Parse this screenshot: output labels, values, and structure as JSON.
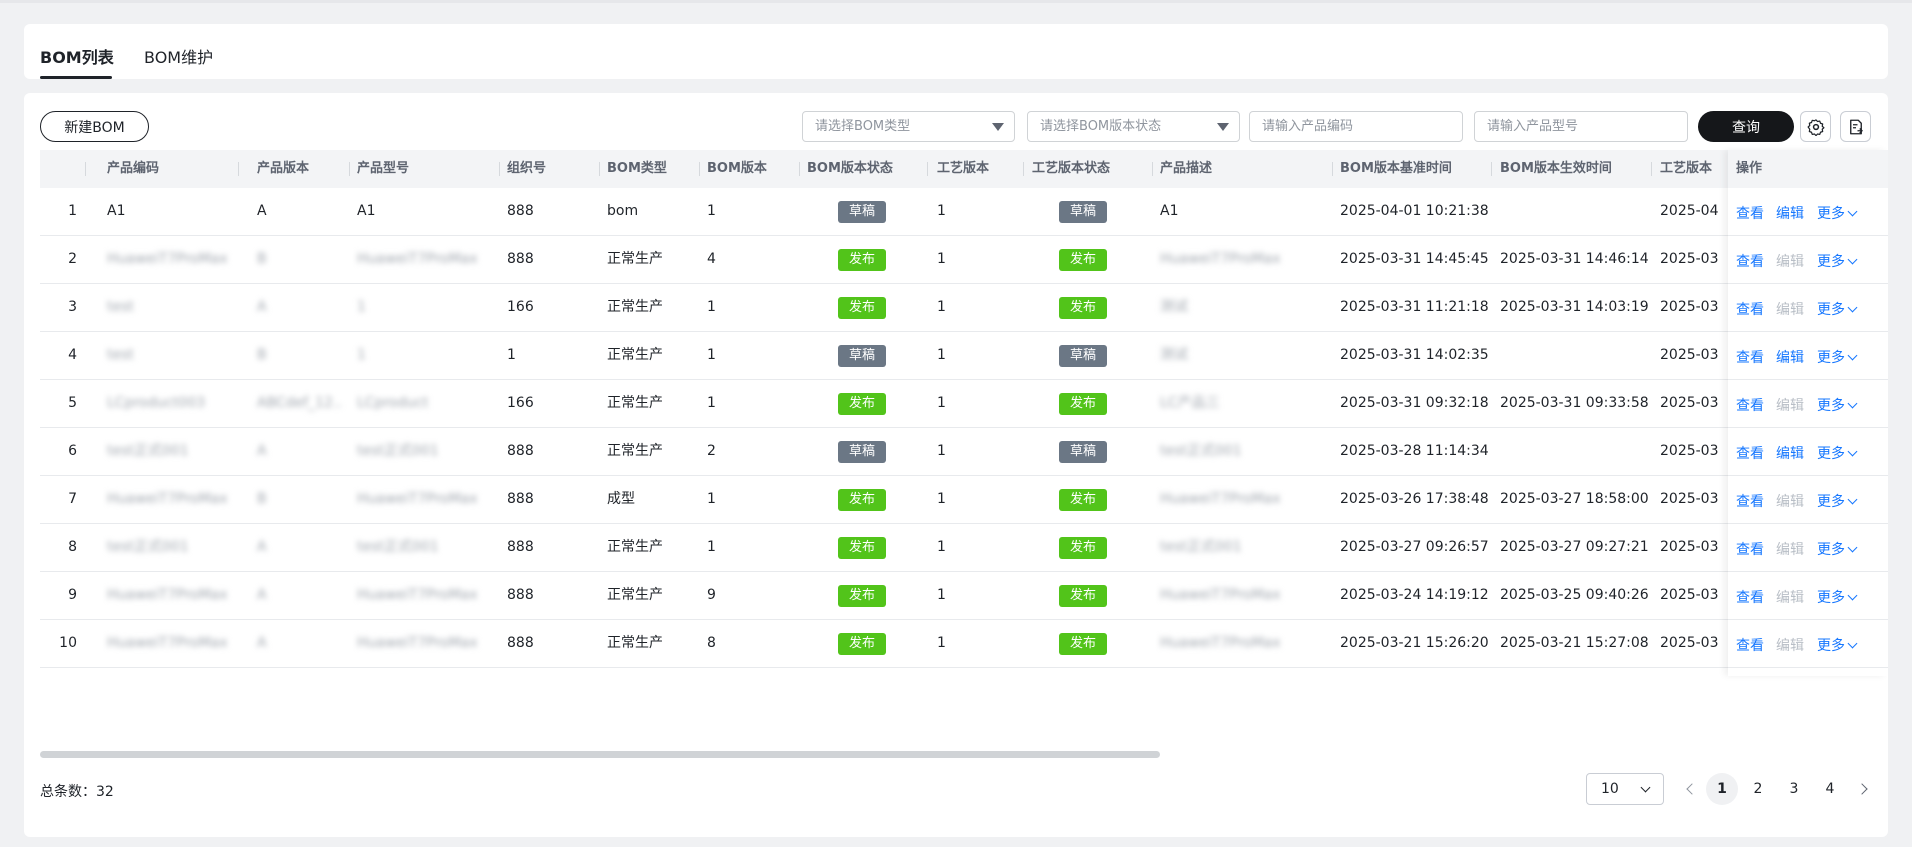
{
  "tabs": [
    {
      "label": "BOM列表",
      "active": true
    },
    {
      "label": "BOM维护",
      "active": false
    }
  ],
  "toolbar": {
    "new_button": "新建BOM",
    "bom_type_placeholder": "请选择BOM类型",
    "bom_status_placeholder": "请选择BOM版本状态",
    "product_code_placeholder": "请输入产品编码",
    "product_model_placeholder": "请输入产品型号",
    "query_button": "查询"
  },
  "columns": [
    "产品编码",
    "产品版本",
    "产品型号",
    "组织号",
    "BOM类型",
    "BOM版本",
    "BOM版本状态",
    "工艺版本",
    "工艺版本状态",
    "产品描述",
    "BOM版本基准时间",
    "BOM版本生效时间",
    "工艺版本",
    "操作"
  ],
  "rows": [
    {
      "idx": "1",
      "code": "A1",
      "ver": "A",
      "model": "A1",
      "org": "888",
      "type": "bom",
      "bomver": "1",
      "bomstatus": "草稿",
      "procver": "1",
      "procstatus": "草稿",
      "desc": "A1",
      "basetime": "2025-04-01 10:21:38",
      "efftime": "",
      "proc2": "2025-04",
      "blur": false
    },
    {
      "idx": "2",
      "code": "HuaweiT7ProMax",
      "ver": "B",
      "model": "HuaweiT7ProMax",
      "org": "888",
      "type": "正常生产",
      "bomver": "4",
      "bomstatus": "发布",
      "procver": "1",
      "procstatus": "发布",
      "desc": "HuaweiT7ProMax",
      "basetime": "2025-03-31 14:45:45",
      "efftime": "2025-03-31 14:46:14",
      "proc2": "2025-03",
      "blur": true
    },
    {
      "idx": "3",
      "code": "test",
      "ver": "A",
      "model": "1",
      "org": "166",
      "type": "正常生产",
      "bomver": "1",
      "bomstatus": "发布",
      "procver": "1",
      "procstatus": "发布",
      "desc": "测试",
      "basetime": "2025-03-31 11:21:18",
      "efftime": "2025-03-31 14:03:19",
      "proc2": "2025-03",
      "blur": true
    },
    {
      "idx": "4",
      "code": "test",
      "ver": "B",
      "model": "1",
      "org": "1",
      "type": "正常生产",
      "bomver": "1",
      "bomstatus": "草稿",
      "procver": "1",
      "procstatus": "草稿",
      "desc": "测试",
      "basetime": "2025-03-31 14:02:35",
      "efftime": "",
      "proc2": "2025-03",
      "blur": true
    },
    {
      "idx": "5",
      "code": "LCproduct003",
      "ver": "ABCdef_12...",
      "model": "LCproduct",
      "org": "166",
      "type": "正常生产",
      "bomver": "1",
      "bomstatus": "发布",
      "procver": "1",
      "procstatus": "发布",
      "desc": "LC产品三",
      "basetime": "2025-03-31 09:32:18",
      "efftime": "2025-03-31 09:33:58",
      "proc2": "2025-03",
      "blur": true
    },
    {
      "idx": "6",
      "code": "test正式001",
      "ver": "A",
      "model": "test正式001",
      "org": "888",
      "type": "正常生产",
      "bomver": "2",
      "bomstatus": "草稿",
      "procver": "1",
      "procstatus": "草稿",
      "desc": "test正式001",
      "basetime": "2025-03-28 11:14:34",
      "efftime": "",
      "proc2": "2025-03",
      "blur": true
    },
    {
      "idx": "7",
      "code": "HuaweiT7ProMax",
      "ver": "B",
      "model": "HuaweiT7ProMax",
      "org": "888",
      "type": "成型",
      "bomver": "1",
      "bomstatus": "发布",
      "procver": "1",
      "procstatus": "发布",
      "desc": "HuaweiT7ProMax",
      "basetime": "2025-03-26 17:38:48",
      "efftime": "2025-03-27 18:58:00",
      "proc2": "2025-03",
      "blur": true
    },
    {
      "idx": "8",
      "code": "test正式001",
      "ver": "A",
      "model": "test正式001",
      "org": "888",
      "type": "正常生产",
      "bomver": "1",
      "bomstatus": "发布",
      "procver": "1",
      "procstatus": "发布",
      "desc": "test正式001",
      "basetime": "2025-03-27 09:26:57",
      "efftime": "2025-03-27 09:27:21",
      "proc2": "2025-03",
      "blur": true
    },
    {
      "idx": "9",
      "code": "HuaweiT7ProMax",
      "ver": "A",
      "model": "HuaweiT7ProMax",
      "org": "888",
      "type": "正常生产",
      "bomver": "9",
      "bomstatus": "发布",
      "procver": "1",
      "procstatus": "发布",
      "desc": "HuaweiT7ProMax",
      "basetime": "2025-03-24 14:19:12",
      "efftime": "2025-03-25 09:40:26",
      "proc2": "2025-03",
      "blur": true
    },
    {
      "idx": "10",
      "code": "HuaweiT7ProMax",
      "ver": "A",
      "model": "HuaweiT7ProMax",
      "org": "888",
      "type": "正常生产",
      "bomver": "8",
      "bomstatus": "发布",
      "procver": "1",
      "procstatus": "发布",
      "desc": "HuaweiT7ProMax",
      "basetime": "2025-03-21 15:26:20",
      "efftime": "2025-03-21 15:27:08",
      "proc2": "2025-03",
      "blur": true
    }
  ],
  "row_actions": {
    "view": "查看",
    "edit": "编辑",
    "more": "更多",
    "edit_enabled_rows": [
      1,
      4,
      6
    ]
  },
  "footer": {
    "total": "总条数：32",
    "page_size": "10",
    "pages": [
      "1",
      "2",
      "3",
      "4"
    ],
    "current_page": "1"
  },
  "colors": {
    "draft": "#6b7785",
    "published": "#52c41a",
    "link": "#1677ff",
    "primary": "#15171a"
  }
}
